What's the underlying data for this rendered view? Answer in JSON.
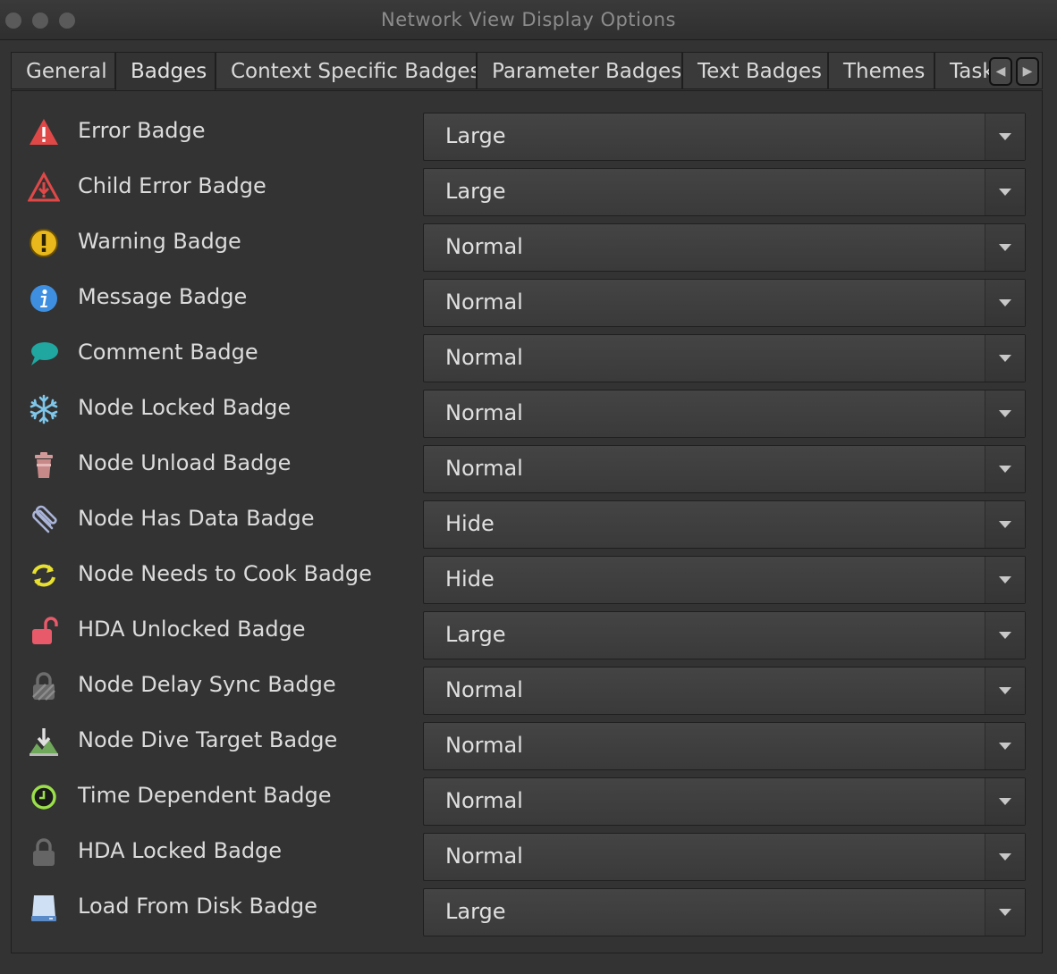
{
  "window": {
    "title": "Network View Display Options"
  },
  "tabs": [
    {
      "label": "General",
      "active": false
    },
    {
      "label": "Badges",
      "active": true
    },
    {
      "label": "Context Specific Badges",
      "active": false
    },
    {
      "label": "Parameter Badges",
      "active": false
    },
    {
      "label": "Text Badges",
      "active": false
    },
    {
      "label": "Themes",
      "active": false
    },
    {
      "label": "Task",
      "active": false
    }
  ],
  "tab_scroll": {
    "left_icon": "chevron-left-icon",
    "right_icon": "chevron-right-icon"
  },
  "badges": [
    {
      "label": "Error Badge",
      "value": "Large",
      "icon": "error-triangle-icon"
    },
    {
      "label": "Child Error Badge",
      "value": "Large",
      "icon": "child-error-icon"
    },
    {
      "label": "Warning Badge",
      "value": "Normal",
      "icon": "warning-icon"
    },
    {
      "label": "Message Badge",
      "value": "Normal",
      "icon": "info-icon"
    },
    {
      "label": "Comment Badge",
      "value": "Normal",
      "icon": "comment-icon"
    },
    {
      "label": "Node Locked Badge",
      "value": "Normal",
      "icon": "snowflake-icon"
    },
    {
      "label": "Node Unload Badge",
      "value": "Normal",
      "icon": "trash-icon"
    },
    {
      "label": "Node Has Data Badge",
      "value": "Hide",
      "icon": "paperclip-icon"
    },
    {
      "label": "Node Needs to Cook Badge",
      "value": "Hide",
      "icon": "refresh-icon"
    },
    {
      "label": "HDA Unlocked Badge",
      "value": "Large",
      "icon": "unlocked-icon"
    },
    {
      "label": "Node Delay Sync Badge",
      "value": "Normal",
      "icon": "delay-sync-icon"
    },
    {
      "label": "Node Dive Target Badge",
      "value": "Normal",
      "icon": "dive-target-icon"
    },
    {
      "label": "Time Dependent Badge",
      "value": "Normal",
      "icon": "clock-icon"
    },
    {
      "label": "HDA Locked Badge",
      "value": "Normal",
      "icon": "locked-icon"
    },
    {
      "label": "Load From Disk Badge",
      "value": "Large",
      "icon": "disk-icon"
    }
  ]
}
